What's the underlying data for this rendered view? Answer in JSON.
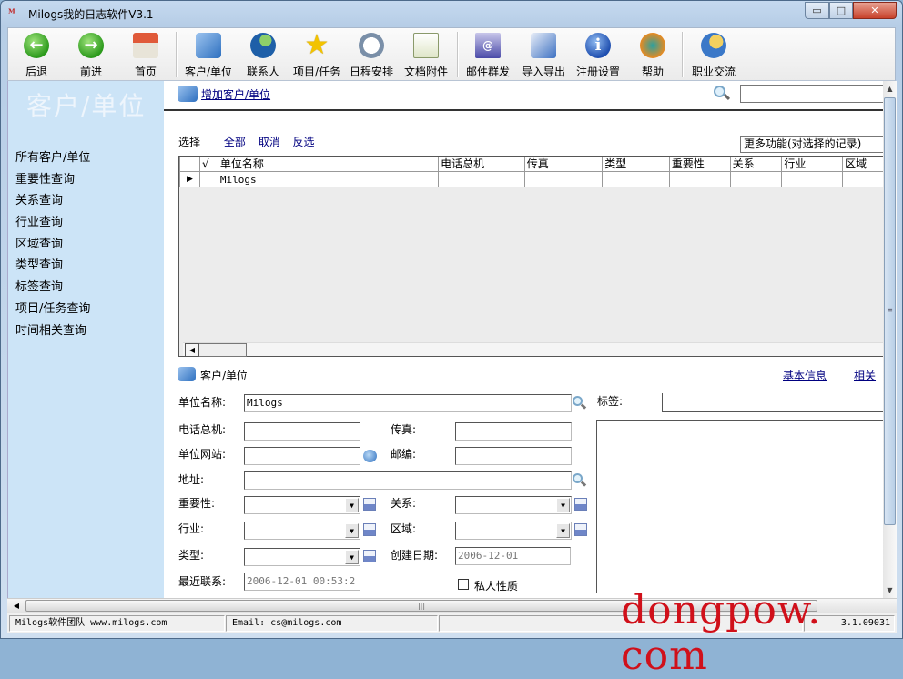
{
  "window": {
    "title": "Milogs我的日志软件V3.1",
    "app_icon": "milogs-logo-icon",
    "controls": {
      "minimize": "▭",
      "maximize": "□",
      "close": "✕"
    }
  },
  "toolbar": {
    "items": [
      {
        "label": "后退",
        "icon": "back-arrow-icon",
        "glyph": "←"
      },
      {
        "label": "前进",
        "icon": "forward-arrow-icon",
        "glyph": "→"
      },
      {
        "label": "首页",
        "icon": "home-icon",
        "glyph": ""
      },
      {
        "label": "客户/单位",
        "icon": "customer-icon",
        "glyph": ""
      },
      {
        "label": "联系人",
        "icon": "contact-icon",
        "glyph": ""
      },
      {
        "label": "项目/任务",
        "icon": "star-icon",
        "glyph": "★"
      },
      {
        "label": "日程安排",
        "icon": "schedule-clock-icon",
        "glyph": ""
      },
      {
        "label": "文档附件",
        "icon": "document-icon",
        "glyph": ""
      },
      {
        "label": "邮件群发",
        "icon": "mail-icon",
        "glyph": "@"
      },
      {
        "label": "导入导出",
        "icon": "import-export-icon",
        "glyph": ""
      },
      {
        "label": "注册设置",
        "icon": "info-icon",
        "glyph": "i"
      },
      {
        "label": "帮助",
        "icon": "help-globe-icon",
        "glyph": ""
      },
      {
        "label": "职业交流",
        "icon": "career-exchange-icon",
        "glyph": ""
      }
    ]
  },
  "sidebar": {
    "title": "客户/单位",
    "items": [
      "所有客户/单位",
      "重要性查询",
      "关系查询",
      "行业查询",
      "区域查询",
      "类型查询",
      "标签查询",
      "项目/任务查询",
      "时间相关查询"
    ]
  },
  "main": {
    "add_link": "增加客户/单位",
    "search_value": "",
    "select_label": "选择",
    "select_all": "全部",
    "select_cancel": "取消",
    "select_invert": "反选",
    "more_functions": "更多功能(对选择的记录)",
    "grid": {
      "check_header": "√",
      "columns": [
        "单位名称",
        "电话总机",
        "传真",
        "类型",
        "重要性",
        "关系",
        "行业",
        "区域"
      ],
      "rows": [
        {
          "indicator": "▶",
          "checked": false,
          "cells": [
            "Milogs",
            "",
            "",
            "",
            "",
            "",
            "",
            ""
          ]
        }
      ]
    }
  },
  "detail": {
    "section_title": "客户/单位",
    "tabs": [
      "基本信息",
      "相关"
    ],
    "fields": {
      "name": {
        "label": "单位名称:",
        "value": "Milogs"
      },
      "phone": {
        "label": "电话总机:",
        "value": ""
      },
      "fax": {
        "label": "传真:",
        "value": ""
      },
      "website": {
        "label": "单位网站:",
        "value": ""
      },
      "zipcode": {
        "label": "邮编:",
        "value": ""
      },
      "address": {
        "label": "地址:",
        "value": ""
      },
      "importance": {
        "label": "重要性:",
        "value": ""
      },
      "relation": {
        "label": "关系:",
        "value": ""
      },
      "industry": {
        "label": "行业:",
        "value": ""
      },
      "region": {
        "label": "区域:",
        "value": ""
      },
      "type": {
        "label": "类型:",
        "value": ""
      },
      "created": {
        "label": "创建日期:",
        "value": "2006-12-01"
      },
      "last_contact": {
        "label": "最近联系:",
        "value": "2006-12-01 00:53:2"
      },
      "tags": {
        "label": "标签:",
        "value": ""
      },
      "private": {
        "label": "私人性质",
        "checked": false
      }
    }
  },
  "statusbar": {
    "team": "Milogs软件团队   www.milogs.com",
    "email": "Email:  cs@milogs.com",
    "extra": "",
    "version": "3.1.09031"
  },
  "watermark": "dongpow. com"
}
